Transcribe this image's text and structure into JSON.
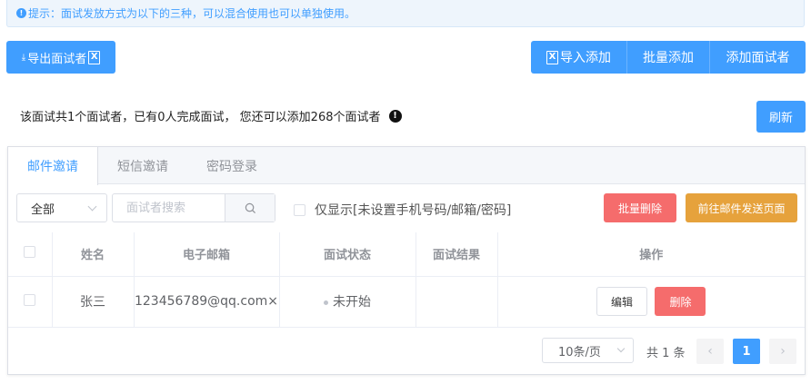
{
  "tip": {
    "text": "提示：面试发放方式为以下的三种，可以混合使用也可以单独使用。"
  },
  "toolbar": {
    "export_label": "导出面试者",
    "import_label": "导入添加",
    "batch_add_label": "批量添加",
    "add_label": "添加面试者"
  },
  "summary": {
    "text": "该面试共1个面试者，已有0人完成面试， 您还可以添加268个面试者",
    "refresh_label": "刷新"
  },
  "tabs": [
    {
      "label": "邮件邀请",
      "active": true
    },
    {
      "label": "短信邀请",
      "active": false
    },
    {
      "label": "密码登录",
      "active": false
    }
  ],
  "filters": {
    "status_select": "全部",
    "search_placeholder": "面试者搜索",
    "only_unset_label": "仅显示[未设置手机号码/邮箱/密码]",
    "batch_delete_label": "批量删除",
    "goto_mail_label": "前往邮件发送页面"
  },
  "table": {
    "headers": [
      "姓名",
      "电子邮箱",
      "面试状态",
      "面试结果",
      "操作"
    ],
    "rows": [
      {
        "name": "张三",
        "email": "123456789@qq.com",
        "status": "未开始",
        "result": "",
        "edit_label": "编辑",
        "delete_label": "删除"
      }
    ]
  },
  "pagination": {
    "page_size": "10条/页",
    "total": "共 1 条",
    "current_page": "1"
  },
  "colors": {
    "primary": "#409eff",
    "danger": "#f56c6c",
    "warning": "#e6a23c"
  }
}
